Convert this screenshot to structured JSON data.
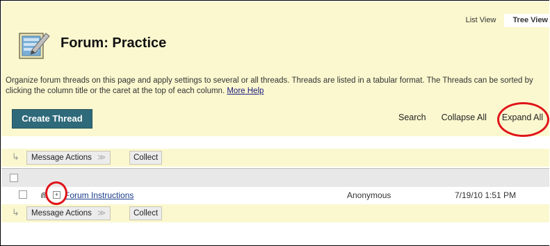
{
  "view_tabs": {
    "list_view": "List View",
    "tree_view": "Tree View"
  },
  "forum": {
    "title": "Forum: Practice",
    "description": "Organize forum threads on this page and apply settings to several or all threads. Threads are listed in a tabular format. The Threads can be sorted by clicking the column title or the caret at the top of each column.",
    "more_help": "More Help"
  },
  "toolbar": {
    "create_thread": "Create Thread",
    "search": "Search",
    "collapse_all": "Collapse All",
    "expand_all": "Expand All"
  },
  "actions": {
    "message_actions": "Message Actions",
    "collect": "Collect"
  },
  "threads": [
    {
      "title": "Forum Instructions",
      "author": "Anonymous",
      "date": "7/19/10 1:51 PM"
    }
  ],
  "annotation_color": "#e0141a"
}
